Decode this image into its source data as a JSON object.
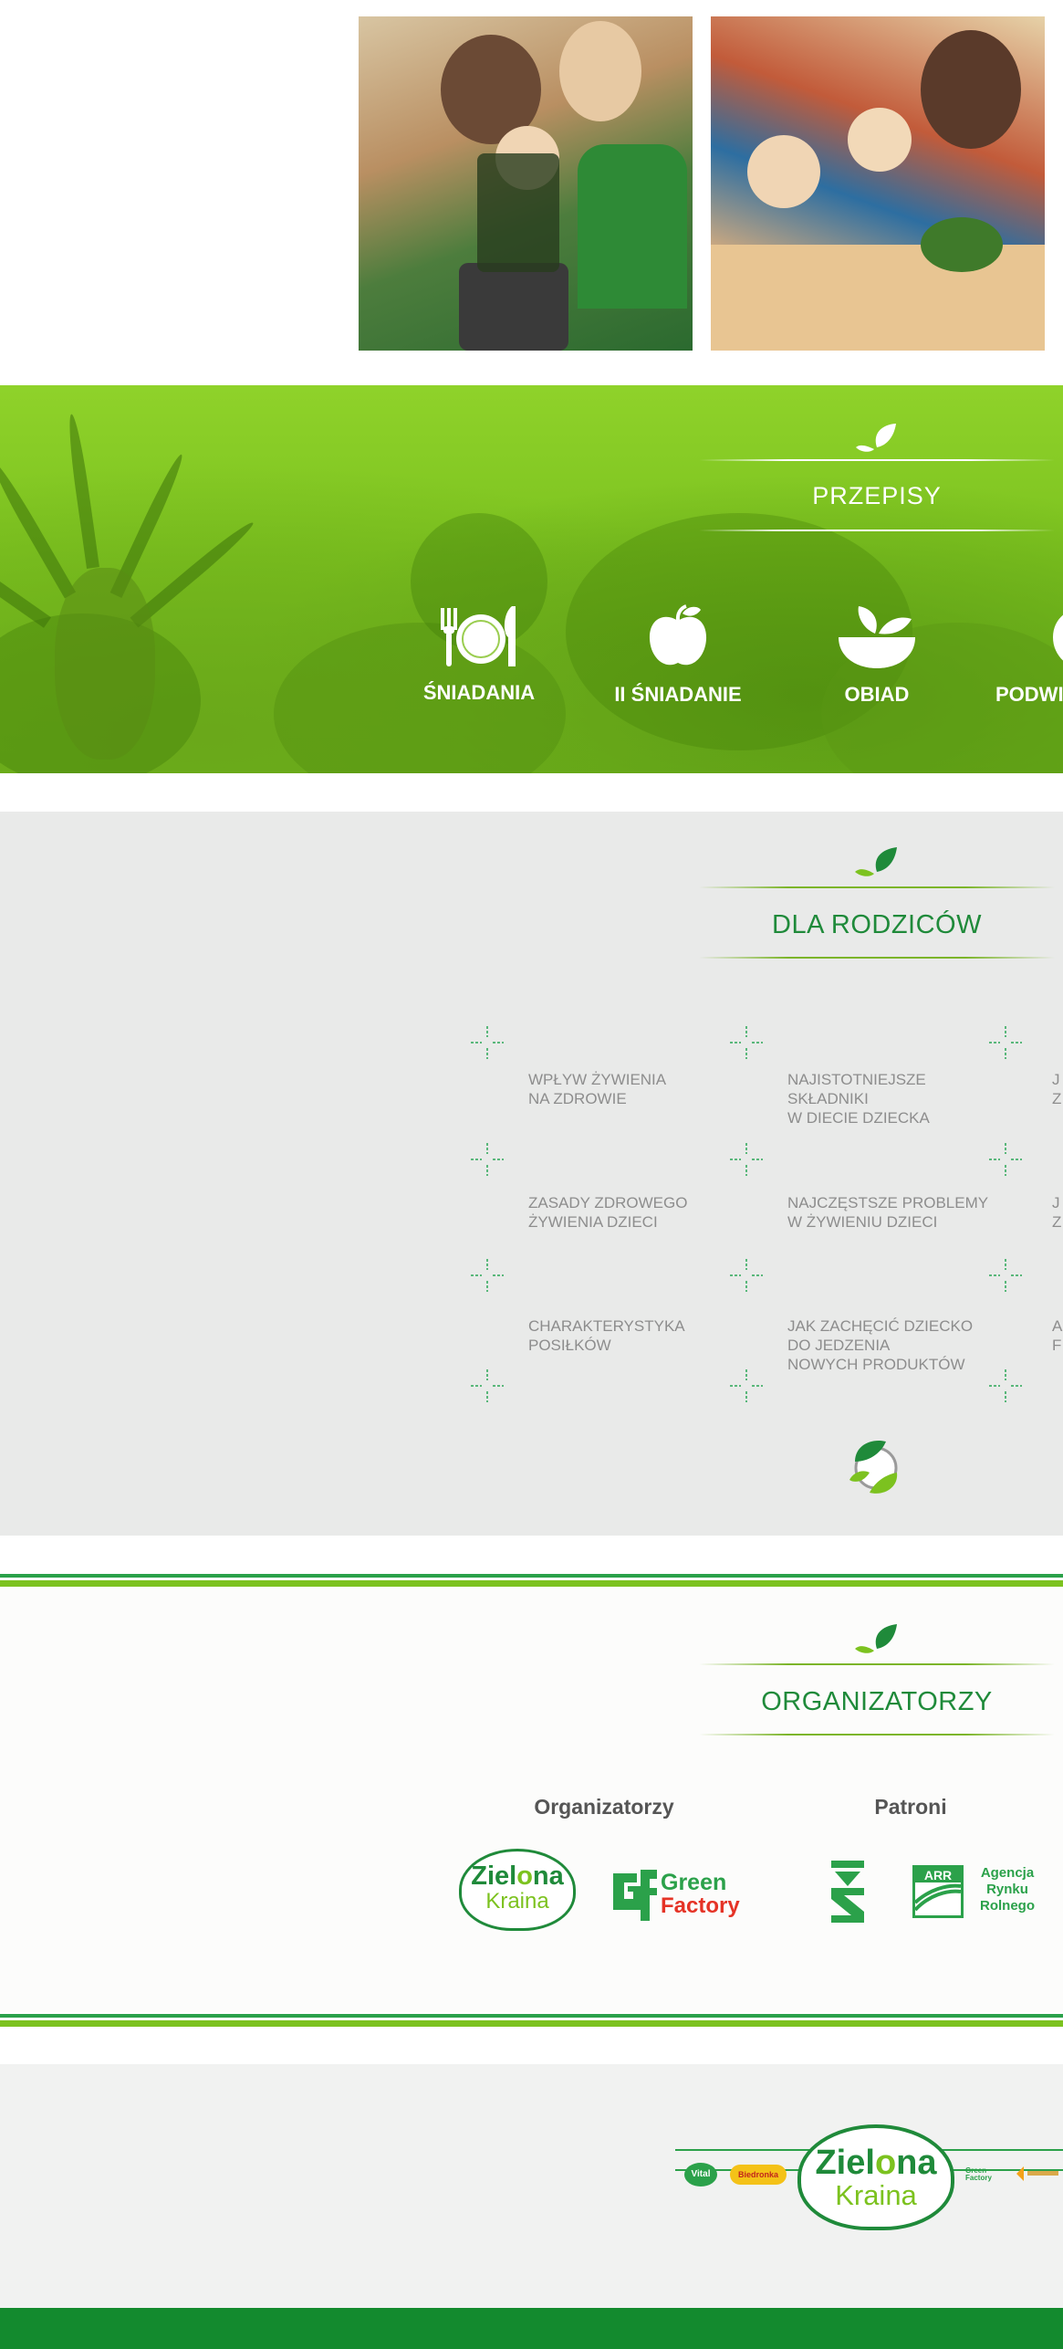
{
  "photos": {
    "left_alt": "children-blender-photo",
    "right_alt": "children-table-photo"
  },
  "recipes": {
    "title": "PRZEPISY",
    "categories": [
      {
        "label": "ŚNIADANIA",
        "icon": "plate-cutlery-icon"
      },
      {
        "label": "II ŚNIADANIE",
        "icon": "apple-icon"
      },
      {
        "label": "OBIAD",
        "icon": "bowl-icon"
      },
      {
        "label": "PODWI",
        "icon": "snack-icon"
      }
    ]
  },
  "parents": {
    "title": "DLA RODZICÓW",
    "topics": [
      "WPŁYW ŻYWIENIA\nNA ZDROWIE",
      "NAJISTOTNIEJSZE\nSKŁADNIKI\nW DIECIE DZIECKA",
      "J\nZ",
      "ZASADY ZDROWEGO\nŻYWIENIA DZIECI",
      "NAJCZĘSTSZE PROBLEMY\nW ŻYWIENIU DZIECI",
      "J\nZ",
      "CHARAKTERYSTYKA\nPOSIŁKÓW",
      "JAK ZACHĘCIĆ DZIECKO\nDO JEDZENIA\nNOWYCH PRODUKTÓW",
      "A\nF"
    ]
  },
  "organizers": {
    "title": "ORGANIZATORZY",
    "organizers_label": "Organizatorzy",
    "patrons_label": "Patroni",
    "zielona_line1": "Ziel",
    "zielona_o": "o",
    "zielona_line1b": "na",
    "zielona_line2": "Kraina",
    "green": "Green",
    "factory": "Factory",
    "arr_badge": "ARR",
    "arr_text": [
      "Agencja",
      "Rynku",
      "Rolnego"
    ]
  },
  "footer": {
    "vital": "Vital",
    "biedronka": "Biedronka",
    "zielona_line1": "Ziel",
    "zielona_o": "o",
    "zielona_line1b": "na",
    "zielona_line2": "Kraina",
    "gf": "Green Factory"
  },
  "colors": {
    "brand_green": "#1f8a3a",
    "lime": "#7cc21f",
    "footer_bar": "#138a2e",
    "topic_grey": "#8d8d8d"
  }
}
